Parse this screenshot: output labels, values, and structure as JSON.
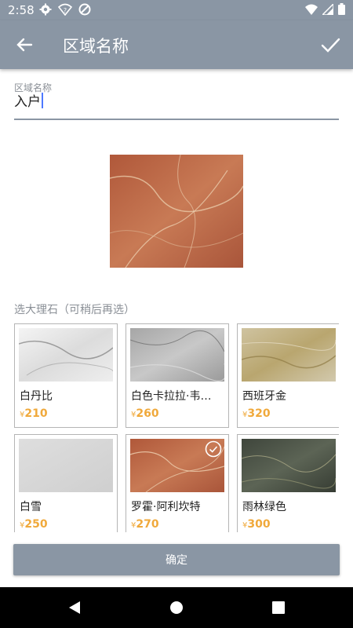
{
  "status_bar": {
    "time": "2:58",
    "left_icons": [
      "gear-icon",
      "wifi-question-icon",
      "sync-blocked-icon"
    ],
    "right_icons": [
      "wifi-icon",
      "signal-icon",
      "battery-icon"
    ]
  },
  "app_bar": {
    "title": "区域名称",
    "back_icon": "arrow-left-icon",
    "confirm_icon": "check-icon"
  },
  "area_field": {
    "label": "区域名称",
    "value": "入户"
  },
  "section_label": "选大理石（可稍后再选）",
  "currency_symbol": "¥",
  "marbles": [
    {
      "name": "白丹比",
      "price": "210",
      "selected": false
    },
    {
      "name": "白色卡拉拉·韦…",
      "price": "260",
      "selected": false
    },
    {
      "name": "西班牙金",
      "price": "320",
      "selected": false
    },
    {
      "name": "白雪",
      "price": "250",
      "selected": false
    },
    {
      "name": "罗霍·阿利坎特",
      "price": "270",
      "selected": true
    },
    {
      "name": "雨林绿色",
      "price": "300",
      "selected": false
    }
  ],
  "confirm_button": "确定",
  "colors": {
    "primary": "#8a96a4",
    "price": "#f0a93b"
  }
}
